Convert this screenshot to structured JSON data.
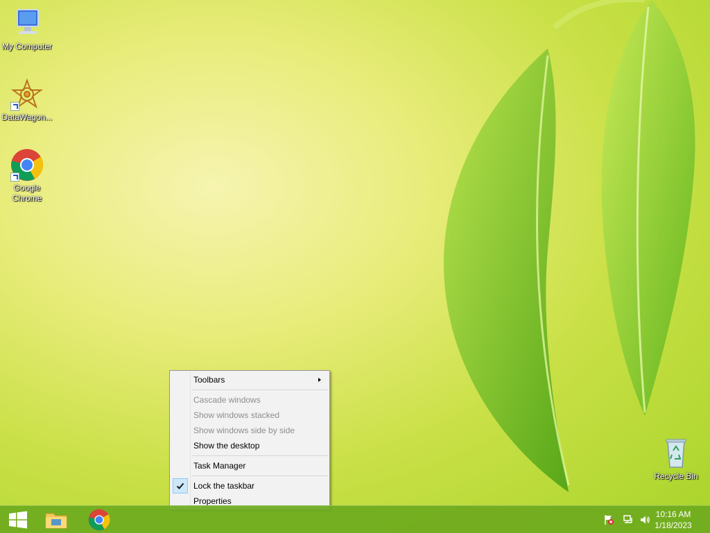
{
  "desktop": {
    "icons": [
      {
        "label": "My Computer",
        "icon": "computer-icon"
      },
      {
        "label": "DataWagon...",
        "icon": "datawagon-icon"
      },
      {
        "label": "Google Chrome",
        "icon": "chrome-icon"
      },
      {
        "label": "Recycle Bin",
        "icon": "recycle-bin-icon"
      }
    ]
  },
  "context_menu": {
    "items": [
      {
        "label": "Toolbars",
        "enabled": true,
        "has_submenu": true
      },
      {
        "label": "Cascade windows",
        "enabled": false
      },
      {
        "label": "Show windows stacked",
        "enabled": false
      },
      {
        "label": "Show windows side by side",
        "enabled": false
      },
      {
        "label": "Show the desktop",
        "enabled": true
      },
      {
        "label": "Task Manager",
        "enabled": true
      },
      {
        "label": "Lock the taskbar",
        "enabled": true,
        "checked": true
      },
      {
        "label": "Properties",
        "enabled": true
      }
    ]
  },
  "taskbar": {
    "pinned": [
      {
        "icon": "windows-start-icon"
      },
      {
        "icon": "file-explorer-icon"
      },
      {
        "icon": "chrome-icon"
      }
    ],
    "tray_icons": [
      "action-center-flag-icon",
      "network-icon",
      "volume-icon"
    ],
    "clock": {
      "time": "10:16 AM",
      "date": "1/18/2023"
    }
  },
  "colors": {
    "taskbar": "#6eaa1e",
    "menu_background": "#f2f2f2",
    "checked_highlight": "#cde8f8"
  }
}
